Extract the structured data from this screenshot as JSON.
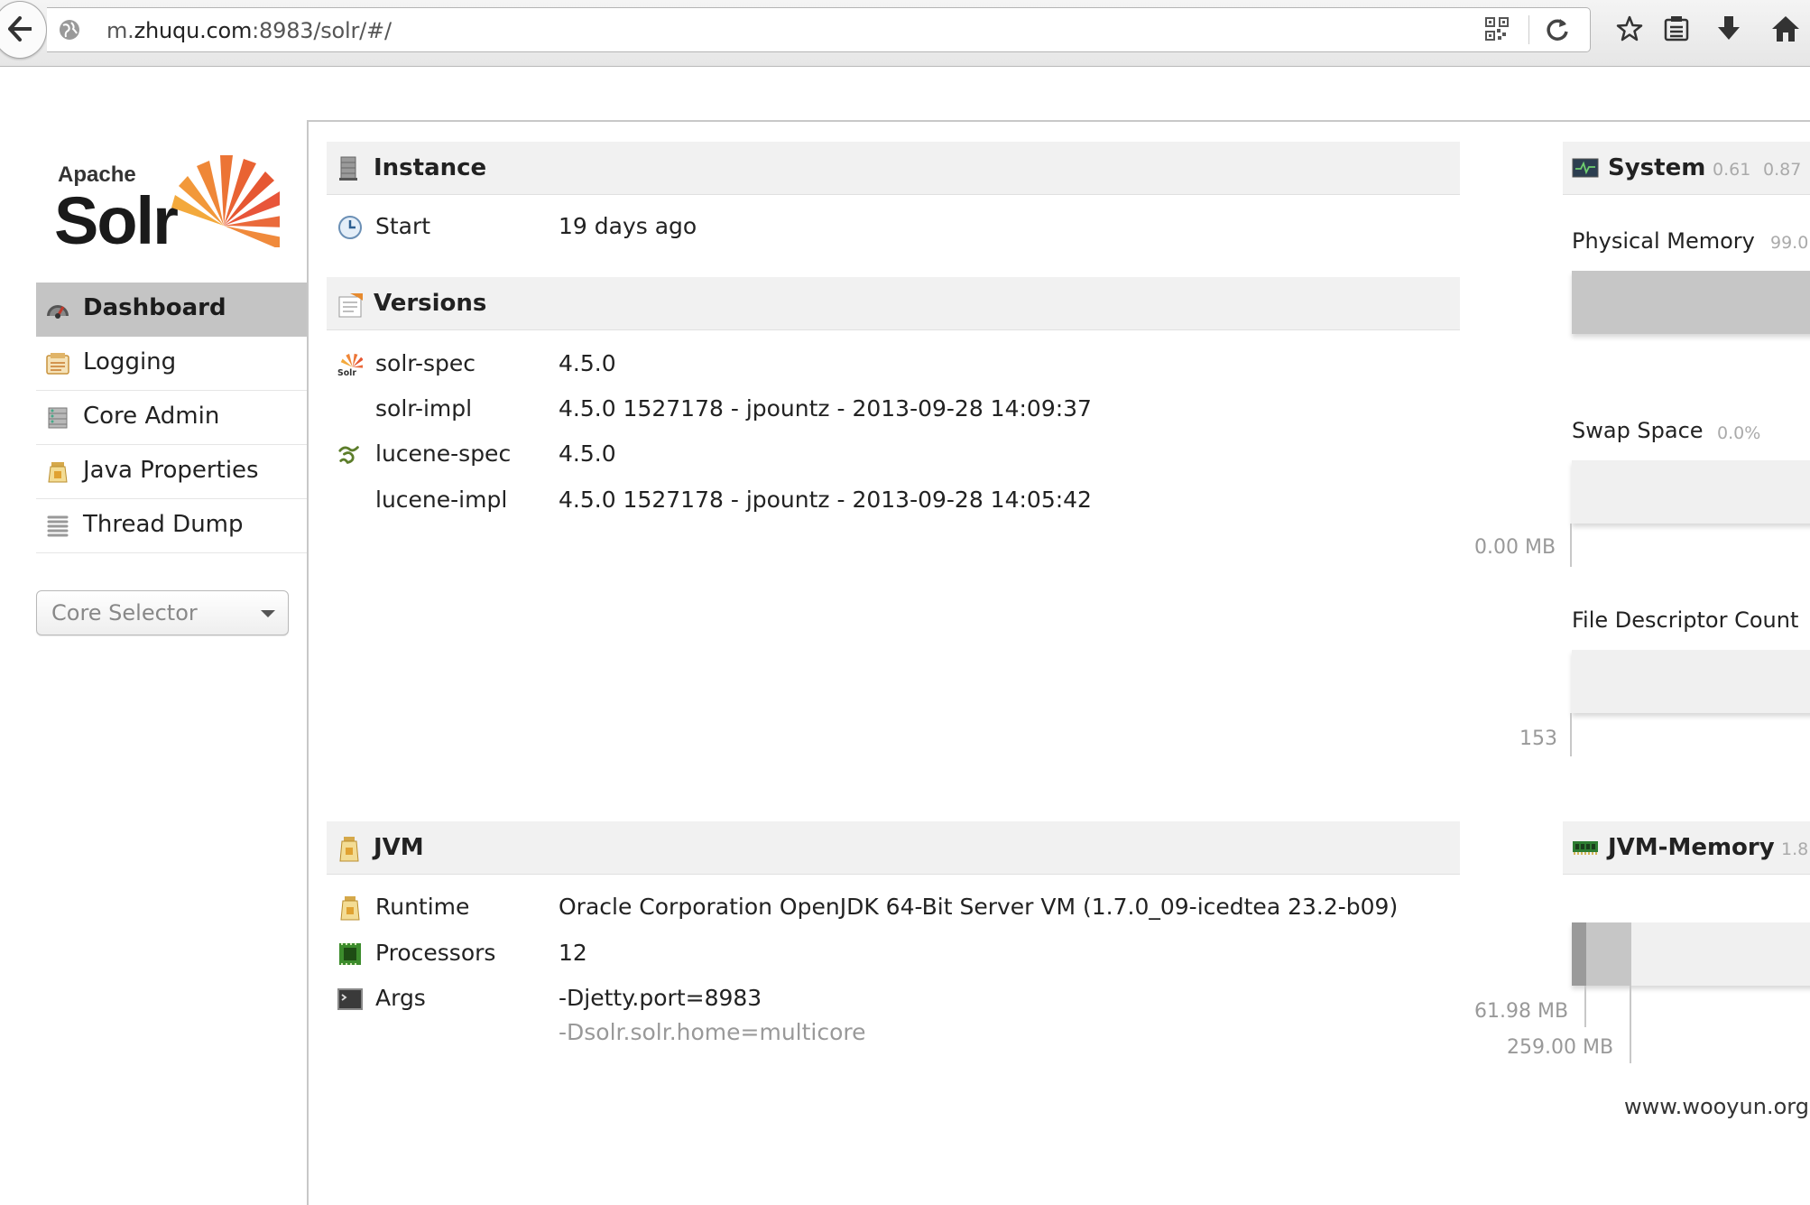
{
  "browser": {
    "url_prefix": "m.",
    "url_domain": "zhuqu.com",
    "url_rest": ":8983/solr/#/"
  },
  "logo": {
    "apache": "Apache",
    "solr": "Solr"
  },
  "nav": {
    "items": [
      {
        "label": "Dashboard",
        "icon": "dashboard-icon"
      },
      {
        "label": "Logging",
        "icon": "logging-icon"
      },
      {
        "label": "Core Admin",
        "icon": "core-admin-icon"
      },
      {
        "label": "Java Properties",
        "icon": "java-properties-icon"
      },
      {
        "label": "Thread Dump",
        "icon": "thread-dump-icon"
      }
    ],
    "core_selector": "Core Selector"
  },
  "instance": {
    "title": "Instance",
    "start_label": "Start",
    "start_value": "19 days ago"
  },
  "versions": {
    "title": "Versions",
    "rows": [
      {
        "label": "solr-spec",
        "value": "4.5.0"
      },
      {
        "label": "solr-impl",
        "value": "4.5.0 1527178 - jpountz - 2013-09-28 14:09:37"
      },
      {
        "label": "lucene-spec",
        "value": "4.5.0"
      },
      {
        "label": "lucene-impl",
        "value": "4.5.0 1527178 - jpountz - 2013-09-28 14:05:42"
      }
    ]
  },
  "jvm": {
    "title": "JVM",
    "rows": [
      {
        "label": "Runtime",
        "value": "Oracle Corporation OpenJDK 64-Bit Server VM (1.7.0_09-icedtea 23.2-b09)"
      },
      {
        "label": "Processors",
        "value": "12"
      },
      {
        "label": "Args",
        "value": "-Djetty.port=8983",
        "value2": "-Dsolr.solr.home=multicore"
      }
    ]
  },
  "system": {
    "title": "System",
    "load1": "0.61",
    "load2": "0.87",
    "physical_memory": {
      "label": "Physical Memory",
      "pct": "99.0",
      "fill": 1.0
    },
    "swap_space": {
      "label": "Swap Space",
      "pct": "0.0%",
      "tick": "0.00 MB",
      "fill": 0.0
    },
    "file_descriptors": {
      "label": "File Descriptor Count",
      "tick": "153"
    }
  },
  "jvm_memory": {
    "title": "JVM-Memory",
    "value": "1.8",
    "used": "61.98 MB",
    "allocated": "259.00 MB"
  },
  "watermark": "www.wooyun.org",
  "colors": {
    "active_nav": "#c4c4c4",
    "header_bg": "#f1f1f1",
    "solr_orange": "#e8553a"
  }
}
